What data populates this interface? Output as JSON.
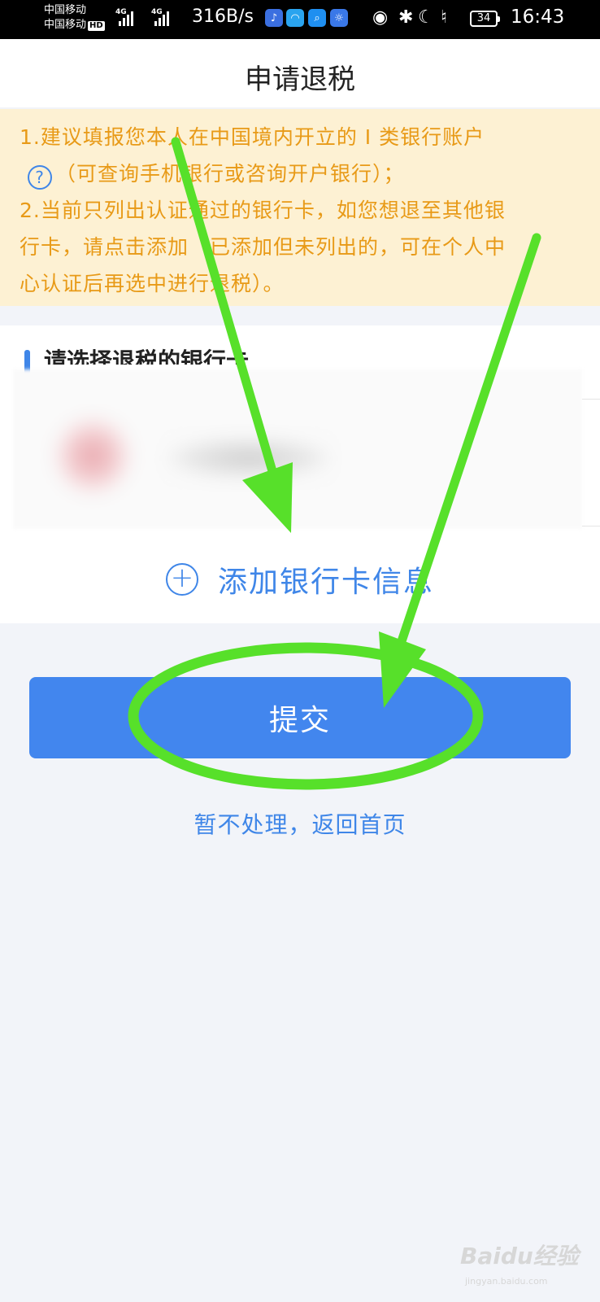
{
  "status_bar": {
    "carrier_1": "中国移动",
    "carrier_2": "中国移动",
    "hd": "HD",
    "net_type": "4G",
    "net_speed": "316B/s",
    "battery": "34",
    "time": "16:43"
  },
  "header": {
    "title": "申请退税"
  },
  "notice": {
    "line1": "1.建议填报您本人在中国境内开立的 I 类银行账户",
    "line2": "（可查询手机银行或咨询开户银行）；",
    "line3": "2.当前只列出认证通过的银行卡，如您想退至其他银",
    "line4": "行卡，请点击添加（已添加但未列出的，可在个人中",
    "line5": "心认证后再选中进行退税）。",
    "help_icon": "?"
  },
  "bank_section": {
    "title": "请选择退税的银行卡",
    "add_label": "添加银行卡信息",
    "add_icon": "+"
  },
  "actions": {
    "submit_label": "提交",
    "back_label": "暂不处理，返回首页"
  },
  "annotation": {
    "color": "#57e02a"
  },
  "watermark": {
    "text": "Baidu经验",
    "sub": "jingyan.baidu.com"
  },
  "colors": {
    "accent": "#4286ee",
    "notice_text": "#e89a17",
    "notice_bg": "#fdf1d3"
  }
}
